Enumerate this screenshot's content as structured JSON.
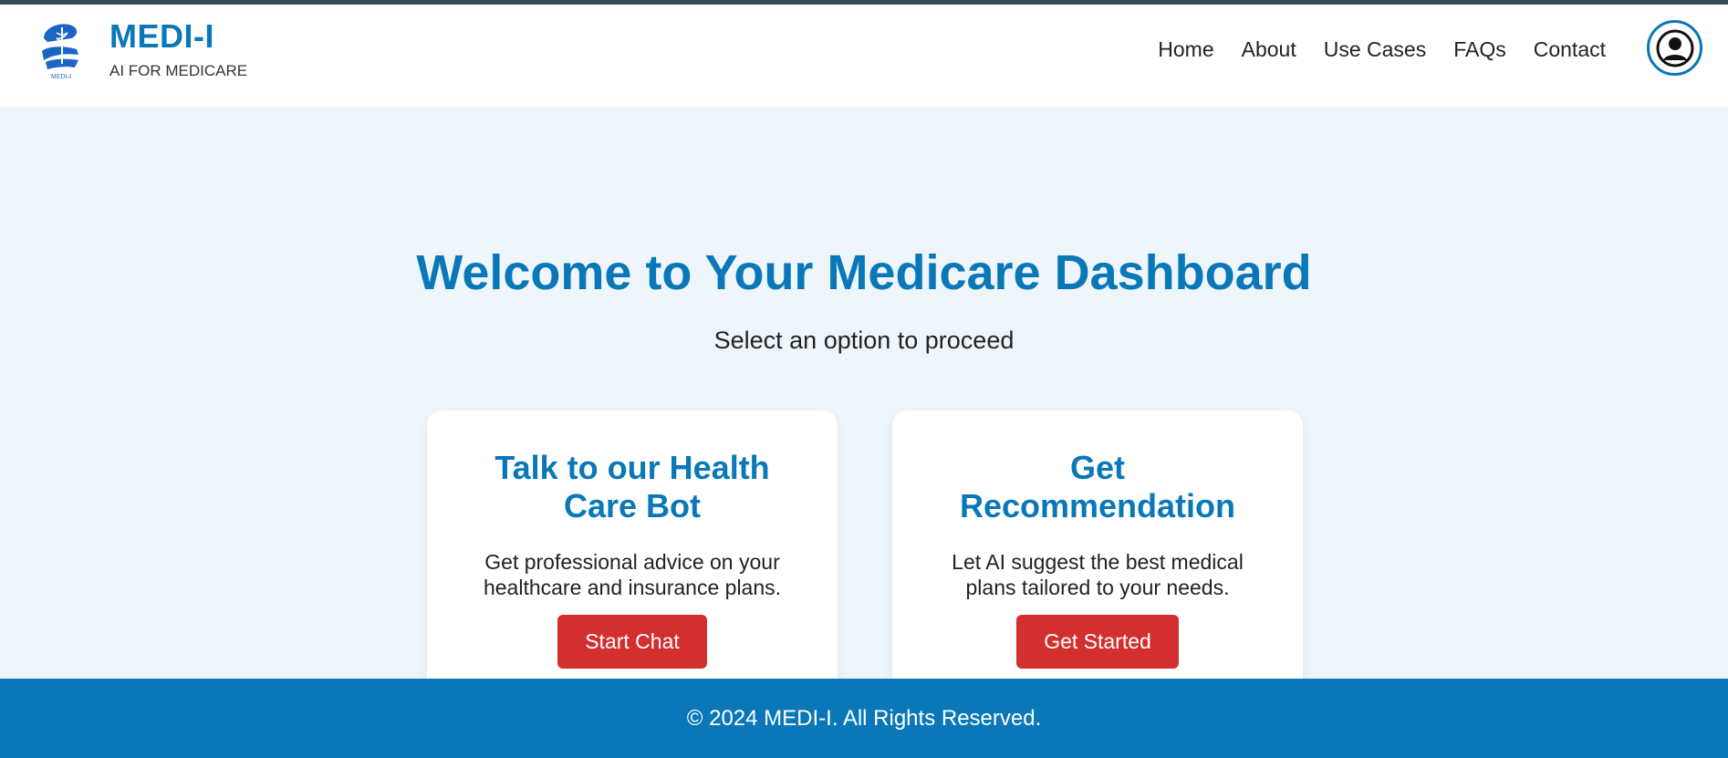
{
  "brand": {
    "name": "MEDI-I",
    "tagline": "AI FOR MEDICARE",
    "logo_caption": "MEDI-I",
    "primary_color": "#0977b8",
    "logo_icon": "hand-holding-caduceus-icon"
  },
  "nav": {
    "items": [
      "Home",
      "About",
      "Use Cases",
      "FAQs",
      "Contact"
    ],
    "profile_icon": "user-circle-icon"
  },
  "hero": {
    "title": "Welcome to Your Medicare Dashboard",
    "subtitle": "Select an option to proceed"
  },
  "cards": [
    {
      "title": "Talk to our Health Care Bot",
      "description": "Get professional advice on your healthcare and insurance plans.",
      "button_label": "Start Chat"
    },
    {
      "title": "Get Recommendation",
      "description": "Let AI suggest the best medical plans tailored to your needs.",
      "button_label": "Get Started"
    }
  ],
  "footer": {
    "text": "© 2024 MEDI-I. All Rights Reserved."
  },
  "colors": {
    "accent": "#0977b8",
    "button": "#d32f2f",
    "page_bg": "#eef6fc"
  }
}
